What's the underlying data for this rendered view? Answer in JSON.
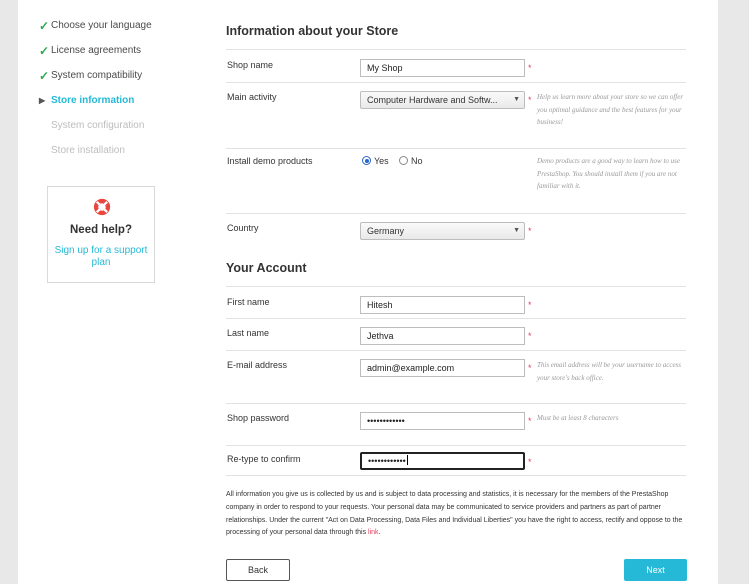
{
  "sidebar": {
    "steps": [
      {
        "label": "Choose your language",
        "state": "done",
        "icon": "check-icon"
      },
      {
        "label": "License agreements",
        "state": "done",
        "icon": "check-icon"
      },
      {
        "label": "System compatibility",
        "state": "done",
        "icon": "check-icon"
      },
      {
        "label": "Store information",
        "state": "current",
        "icon": "current-step-arrow-icon"
      },
      {
        "label": "System configuration",
        "state": "todo"
      },
      {
        "label": "Store installation",
        "state": "todo"
      }
    ],
    "help": {
      "icon": "lifebuoy-icon",
      "title": "Need help?",
      "link": "Sign up for a support plan"
    }
  },
  "store": {
    "heading": "Information about your Store",
    "shop_name": {
      "label": "Shop name",
      "value": "My Shop"
    },
    "main_activity": {
      "label": "Main activity",
      "value": "Computer Hardware and Softw...",
      "hint": "Help us learn more about your store so we can offer you optimal guidance and the best features for your business!"
    },
    "demo_products": {
      "label": "Install demo products",
      "yes": "Yes",
      "no": "No",
      "selected": "Yes",
      "hint": "Demo products are a good way to learn how to use PrestaShop. You should install them if you are not familiar with it."
    },
    "country": {
      "label": "Country",
      "value": "Germany"
    }
  },
  "account": {
    "heading": "Your Account",
    "first_name": {
      "label": "First name",
      "value": "Hitesh"
    },
    "last_name": {
      "label": "Last name",
      "value": "Jethva"
    },
    "email": {
      "label": "E-mail address",
      "value": "admin@example.com",
      "hint": "This email address will be your username to access your store's back office."
    },
    "password": {
      "label": "Shop password",
      "value": "••••••••••••",
      "hint": "Must be at least 8 characters"
    },
    "confirm": {
      "label": "Re-type to confirm",
      "value": "••••••••••••"
    }
  },
  "required_mark": "*",
  "legal": {
    "text": "All information you give us is collected by us and is subject to data processing and statistics, it is necessary for the members of the PrestaShop company in order to respond to your requests. Your personal data may be communicated to service providers and partners as part of partner relationships. Under the current \"Act on Data Processing, Data Files and Individual Liberties\" you have the right to access, rectify and oppose to the processing of your personal data through this ",
    "link": "link",
    "end": "."
  },
  "buttons": {
    "back": "Back",
    "next": "Next"
  },
  "colors": {
    "accent": "#25b9d7",
    "done": "#2fa84f",
    "required": "#e0415f"
  }
}
